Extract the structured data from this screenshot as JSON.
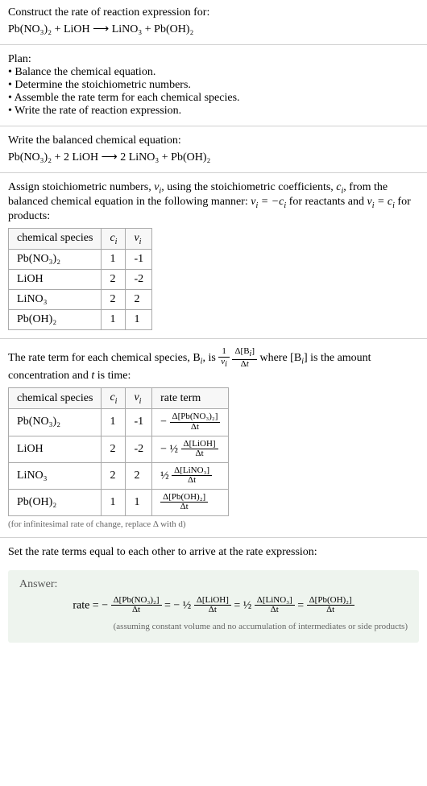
{
  "header": {
    "title": "Construct the rate of reaction expression for:",
    "equation": "Pb(NO₃)₂ + LiOH ⟶ LiNO₃ + Pb(OH)₂"
  },
  "plan": {
    "title": "Plan:",
    "items": [
      "Balance the chemical equation.",
      "Determine the stoichiometric numbers.",
      "Assemble the rate term for each chemical species.",
      "Write the rate of reaction expression."
    ]
  },
  "balanced": {
    "title": "Write the balanced chemical equation:",
    "equation": "Pb(NO₃)₂ + 2 LiOH ⟶ 2 LiNO₃ + Pb(OH)₂"
  },
  "stoich": {
    "intro_a": "Assign stoichiometric numbers, ",
    "intro_b": ", using the stoichiometric coefficients, ",
    "intro_c": ", from the balanced chemical equation in the following manner: ",
    "intro_d": " for reactants and ",
    "intro_e": " for products:",
    "headers": {
      "species": "chemical species",
      "ci": "cᵢ",
      "vi": "νᵢ"
    },
    "rows": [
      {
        "species": "Pb(NO₃)₂",
        "ci": "1",
        "vi": "-1"
      },
      {
        "species": "LiOH",
        "ci": "2",
        "vi": "-2"
      },
      {
        "species": "LiNO₃",
        "ci": "2",
        "vi": "2"
      },
      {
        "species": "Pb(OH)₂",
        "ci": "1",
        "vi": "1"
      }
    ]
  },
  "rate_intro": {
    "a": "The rate term for each chemical species, B",
    "b": ", is ",
    "c": " where [B",
    "d": "] is the amount concentration and ",
    "e": " is time:"
  },
  "rate_table": {
    "headers": {
      "species": "chemical species",
      "ci": "cᵢ",
      "vi": "νᵢ",
      "term": "rate term"
    },
    "rows": [
      {
        "species": "Pb(NO₃)₂",
        "ci": "1",
        "vi": "-1",
        "prefix": "−",
        "num": "Δ[Pb(NO₃)₂]",
        "den": "Δt"
      },
      {
        "species": "LiOH",
        "ci": "2",
        "vi": "-2",
        "prefix": "− ½",
        "num": "Δ[LiOH]",
        "den": "Δt"
      },
      {
        "species": "LiNO₃",
        "ci": "2",
        "vi": "2",
        "prefix": "½",
        "num": "Δ[LiNO₃]",
        "den": "Δt"
      },
      {
        "species": "Pb(OH)₂",
        "ci": "1",
        "vi": "1",
        "prefix": "",
        "num": "Δ[Pb(OH)₂]",
        "den": "Δt"
      }
    ],
    "note": "(for infinitesimal rate of change, replace Δ with d)"
  },
  "final": {
    "title": "Set the rate terms equal to each other to arrive at the rate expression:",
    "answer_label": "Answer:",
    "rate_label": "rate = ",
    "terms": [
      {
        "prefix": "−",
        "num": "Δ[Pb(NO₃)₂]",
        "den": "Δt"
      },
      {
        "prefix": "− ½",
        "num": "Δ[LiOH]",
        "den": "Δt"
      },
      {
        "prefix": "½",
        "num": "Δ[LiNO₃]",
        "den": "Δt"
      },
      {
        "prefix": "",
        "num": "Δ[Pb(OH)₂]",
        "den": "Δt"
      }
    ],
    "assumption": "(assuming constant volume and no accumulation of intermediates or side products)"
  },
  "chart_data": {
    "type": "table",
    "tables": [
      {
        "title": "Stoichiometric numbers",
        "columns": [
          "chemical species",
          "c_i",
          "ν_i"
        ],
        "rows": [
          [
            "Pb(NO3)2",
            1,
            -1
          ],
          [
            "LiOH",
            2,
            -2
          ],
          [
            "LiNO3",
            2,
            2
          ],
          [
            "Pb(OH)2",
            1,
            1
          ]
        ]
      },
      {
        "title": "Rate terms",
        "columns": [
          "chemical species",
          "c_i",
          "ν_i",
          "rate term"
        ],
        "rows": [
          [
            "Pb(NO3)2",
            1,
            -1,
            "-Δ[Pb(NO3)2]/Δt"
          ],
          [
            "LiOH",
            2,
            -2,
            "-(1/2) Δ[LiOH]/Δt"
          ],
          [
            "LiNO3",
            2,
            2,
            "(1/2) Δ[LiNO3]/Δt"
          ],
          [
            "Pb(OH)2",
            1,
            1,
            "Δ[Pb(OH)2]/Δt"
          ]
        ]
      }
    ],
    "rate_expression": "rate = -Δ[Pb(NO3)2]/Δt = -(1/2)Δ[LiOH]/Δt = (1/2)Δ[LiNO3]/Δt = Δ[Pb(OH)2]/Δt"
  }
}
